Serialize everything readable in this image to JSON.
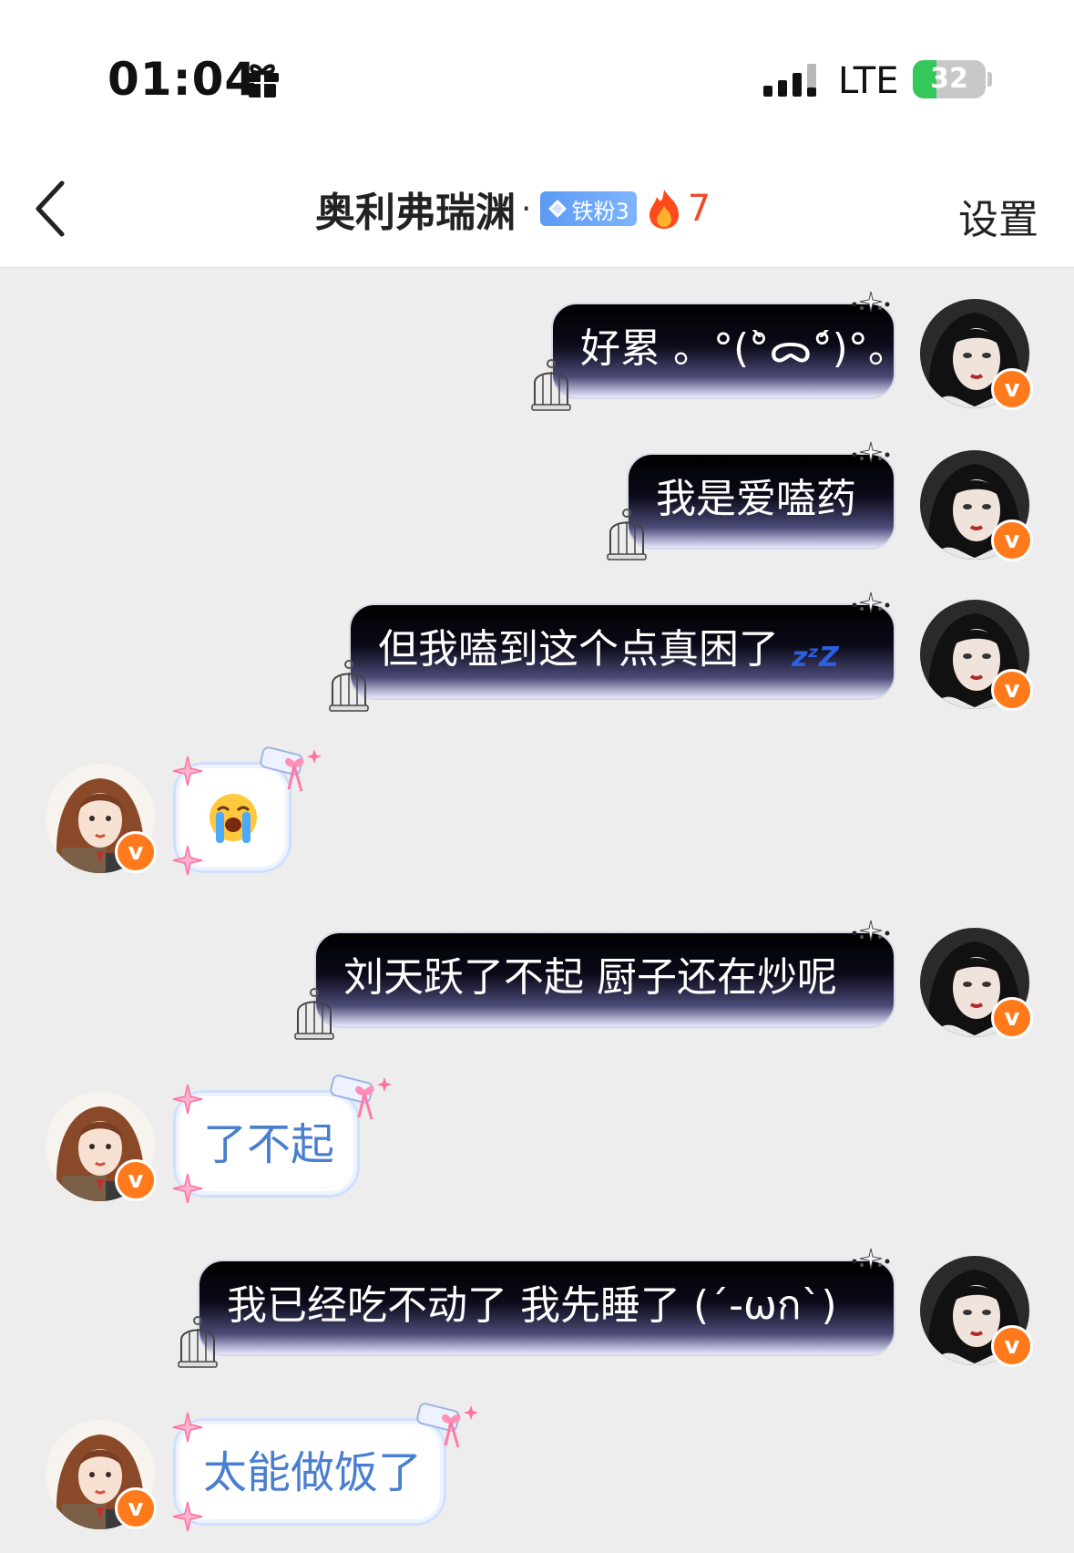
{
  "status_bar": {
    "time": "01:04",
    "network": "LTE",
    "battery": "32",
    "battery_level": 0.32
  },
  "header": {
    "title": "奥利弗瑞渊",
    "separator": "·",
    "fan_badge": "铁粉3",
    "fire_count": "7",
    "settings_label": "设置"
  },
  "colors": {
    "accent_fire": "#f04a2a",
    "fan_badge": "#5a9af5",
    "incoming_text": "#4a7fcf",
    "v_badge": "#ff7a1a"
  },
  "messages": [
    {
      "side": "out",
      "text": "好累 。°(°̀ᯅ°́)°。"
    },
    {
      "side": "out",
      "text": "我是爱嗑药"
    },
    {
      "side": "out",
      "text": "但我嗑到这个点真困了",
      "emoji": "zzz"
    },
    {
      "side": "in",
      "emoji": "loudly-crying-face"
    },
    {
      "side": "out",
      "text": "刘天跃了不起 厨子还在炒呢"
    },
    {
      "side": "in",
      "text": "了不起"
    },
    {
      "side": "out",
      "text": "我已经吃不动了 我先睡了 (´-ωก`)"
    },
    {
      "side": "in",
      "text": "太能做饭了"
    }
  ],
  "zzz": "zᶻZ"
}
